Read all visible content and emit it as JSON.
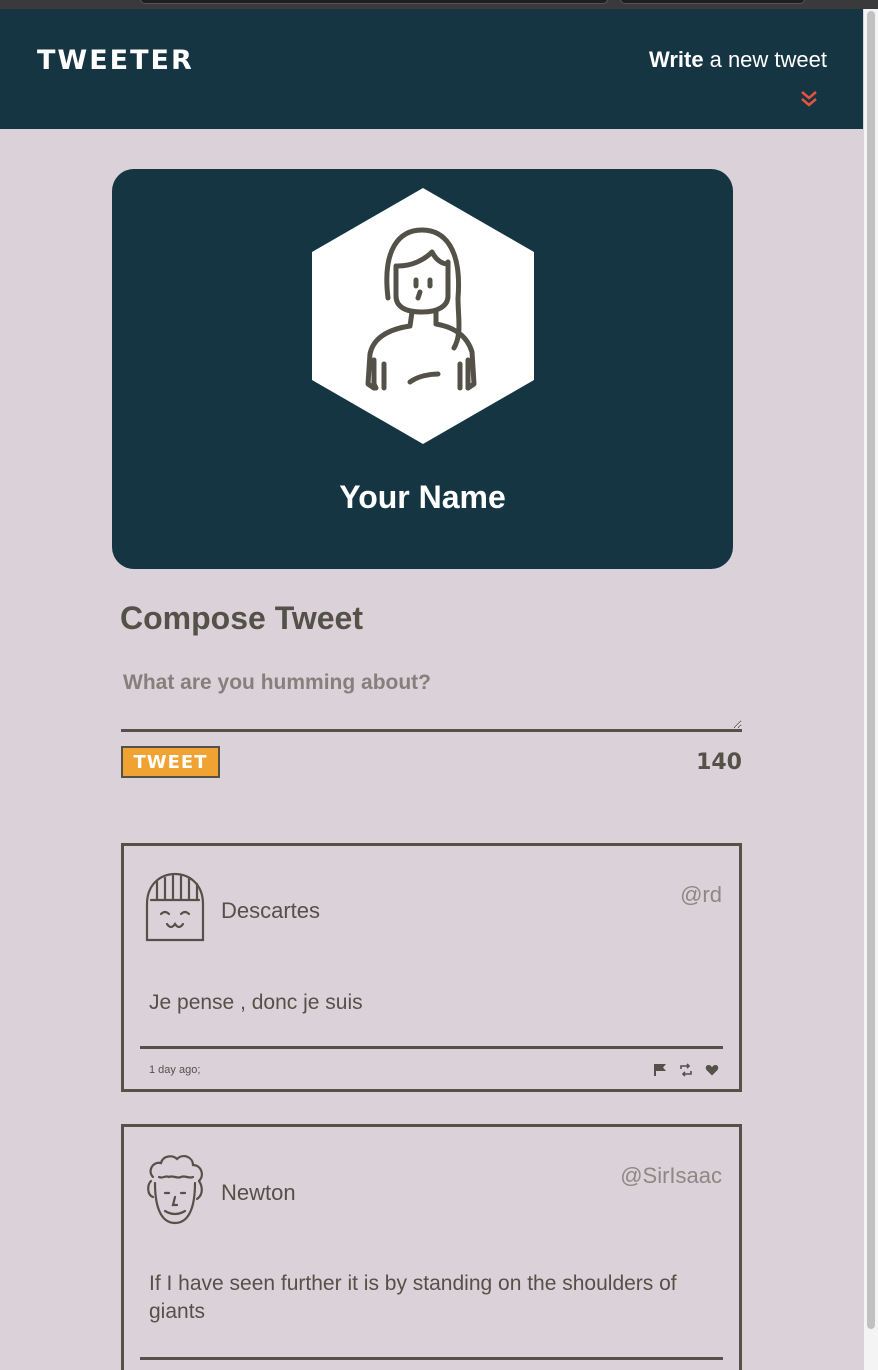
{
  "nav": {
    "logo": "TWEETER",
    "write_bold": "Write",
    "write_rest": "a new tweet",
    "accent_color": "#e8533f"
  },
  "profile": {
    "name": "Your Name"
  },
  "compose": {
    "title": "Compose Tweet",
    "placeholder": "What are you humming about?",
    "button_label": "TWEET",
    "counter": "140"
  },
  "tweets": [
    {
      "author": "Descartes",
      "handle": "@rd",
      "content": "Je pense , donc je suis",
      "timestamp": "1 day ago;",
      "actions": [
        "flag-icon",
        "retweet-icon",
        "heart-icon"
      ]
    },
    {
      "author": "Newton",
      "handle": "@SirIsaac",
      "content": "If I have seen further it is by standing on the shoulders of giants"
    }
  ],
  "colors": {
    "navbar": "#153543",
    "background": "#dbd1d8",
    "text": "#545149",
    "button": "#f0a233"
  }
}
